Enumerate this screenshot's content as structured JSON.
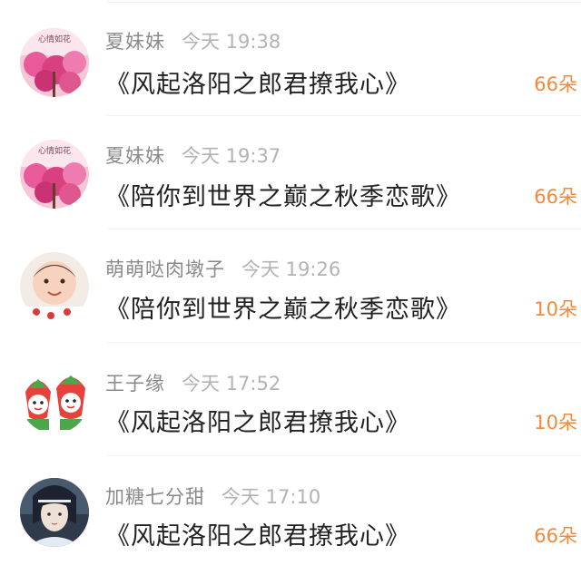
{
  "list": {
    "items": [
      {
        "user": "夏妹妹",
        "time": "今天 19:38",
        "gift": "《风起洛阳之郎君撩我心》",
        "count": "66朵",
        "avatar": "pink-blossom-avatar",
        "avatar_caption": "心情如花"
      },
      {
        "user": "夏妹妹",
        "time": "今天 19:37",
        "gift": "《陪你到世界之巅之秋季恋歌》",
        "count": "66朵",
        "avatar": "pink-blossom-avatar",
        "avatar_caption": "心情如花"
      },
      {
        "user": "萌萌哒肉墩子",
        "time": "今天 19:26",
        "gift": "《陪你到世界之巅之秋季恋歌》",
        "count": "10朵",
        "avatar": "baby-face-avatar"
      },
      {
        "user": "王子缘",
        "time": "今天 17:52",
        "gift": "《风起洛阳之郎君撩我心》",
        "count": "10朵",
        "avatar": "strawberry-cartoon-avatar"
      },
      {
        "user": "加糖七分甜",
        "time": "今天 17:10",
        "gift": "《风起洛阳之郎君撩我心》",
        "count": "66朵",
        "avatar": "anime-character-avatar"
      }
    ]
  },
  "colors": {
    "username": "#8a8a8a",
    "timestamp": "#b3b3b3",
    "title": "#222222",
    "count": "#f08a3c",
    "divider": "#efefef"
  }
}
